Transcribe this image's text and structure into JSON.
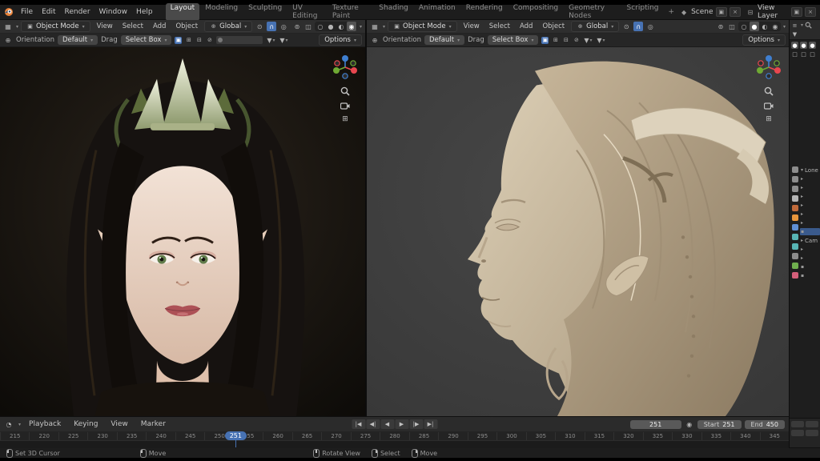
{
  "topbar": {
    "app_menus": [
      "File",
      "Edit",
      "Render",
      "Window",
      "Help"
    ],
    "workspaces": [
      {
        "label": "Layout",
        "active": true
      },
      {
        "label": "Modeling"
      },
      {
        "label": "Sculpting"
      },
      {
        "label": "UV Editing"
      },
      {
        "label": "Texture Paint"
      },
      {
        "label": "Shading"
      },
      {
        "label": "Animation"
      },
      {
        "label": "Rendering"
      },
      {
        "label": "Compositing"
      },
      {
        "label": "Geometry Nodes"
      },
      {
        "label": "Scripting"
      }
    ],
    "add_workspace": "+",
    "scene_label": "Scene",
    "view_layer_label": "View Layer"
  },
  "viewport": {
    "mode": "Object Mode",
    "menus": [
      "View",
      "Select",
      "Add",
      "Object"
    ],
    "orientation": "Global",
    "tool_orientation_label": "Orientation",
    "tool_preset": "Default",
    "tool_drag_label": "Drag",
    "tool_select_mode": "Select Box",
    "options_label": "Options"
  },
  "icons": {
    "dropdown": "▾",
    "editor_viewport": "▦",
    "editor_timeline": "◔",
    "mode_cube": "▣",
    "orientation_globe": "⊕",
    "pivot": "⊙",
    "magnet": "∩",
    "proportional": "◎",
    "overlays": "⊚",
    "xray": "◫",
    "shading_wireframe": "○",
    "shading_solid": "●",
    "shading_material": "◐",
    "shading_rendered": "◉",
    "grid": "⊞",
    "cursor_tool": "⊕",
    "list": "≡",
    "scene": "◆",
    "view_layer": "⊟",
    "new": "▣",
    "close": "×",
    "record": "◉"
  },
  "sidebar": {
    "prop_tabs": [
      {
        "name": "render",
        "color": "#8d8d8d"
      },
      {
        "name": "output",
        "color": "#8d8d8d"
      },
      {
        "name": "view-layer",
        "color": "#8d8d8d"
      },
      {
        "name": "scene",
        "color": "#b5b5b5"
      },
      {
        "name": "world",
        "color": "#c06a3b"
      },
      {
        "name": "object",
        "color": "#e8953c"
      },
      {
        "name": "modifiers",
        "color": "#5f8fd4"
      },
      {
        "name": "particles",
        "color": "#58b5b5"
      },
      {
        "name": "physics",
        "color": "#58b5b5"
      },
      {
        "name": "constraints",
        "color": "#8d8d8d"
      },
      {
        "name": "object-data",
        "color": "#6fae4e"
      },
      {
        "name": "material",
        "color": "#d45f7a"
      }
    ],
    "outliner_rows": [
      {
        "glyph": "▾",
        "label": "Lone"
      },
      {
        "glyph": "▸",
        "label": ""
      },
      {
        "glyph": "▸",
        "label": ""
      },
      {
        "glyph": "▸",
        "label": ""
      },
      {
        "glyph": "▸",
        "label": ""
      },
      {
        "glyph": "▸",
        "label": ""
      },
      {
        "glyph": "▸",
        "label": ""
      },
      {
        "glyph": "▪",
        "label": "",
        "active": true
      },
      {
        "glyph": "▸",
        "label": "Cam"
      },
      {
        "glyph": "▸",
        "label": ""
      },
      {
        "glyph": "▸",
        "label": ""
      },
      {
        "glyph": "▪",
        "label": ""
      },
      {
        "glyph": "▪",
        "label": ""
      }
    ]
  },
  "timeline": {
    "menus": [
      "Playback",
      "Keying",
      "View",
      "Marker"
    ],
    "playback_controls": [
      "|◀",
      "◀|",
      "◀",
      "▶",
      "|▶",
      "▶|"
    ],
    "current_frame": "251",
    "start_label": "Start",
    "start_value": "251",
    "end_label": "End",
    "end_value": "450",
    "ruler_ticks": [
      "215",
      "220",
      "225",
      "230",
      "235",
      "240",
      "245",
      "250",
      "255",
      "260",
      "265",
      "270",
      "275",
      "280",
      "285",
      "290",
      "295",
      "300",
      "305",
      "310",
      "315",
      "320",
      "325",
      "330",
      "335",
      "340",
      "345"
    ]
  },
  "statusbar": {
    "hints": [
      {
        "button": "L",
        "label": "Set 3D Cursor"
      },
      {
        "button": "L",
        "label": "Move"
      },
      {
        "button": "M",
        "label": "Rotate View"
      },
      {
        "button": "R",
        "label": "Select"
      },
      {
        "button": "R",
        "label": "Move"
      }
    ]
  },
  "colors": {
    "accent": "#4772b3",
    "axis_x": "#e8474f",
    "axis_y": "#6fa933",
    "axis_z": "#3f7fd0",
    "clay": "#c4b49c",
    "skin": "#e9d5c6"
  }
}
